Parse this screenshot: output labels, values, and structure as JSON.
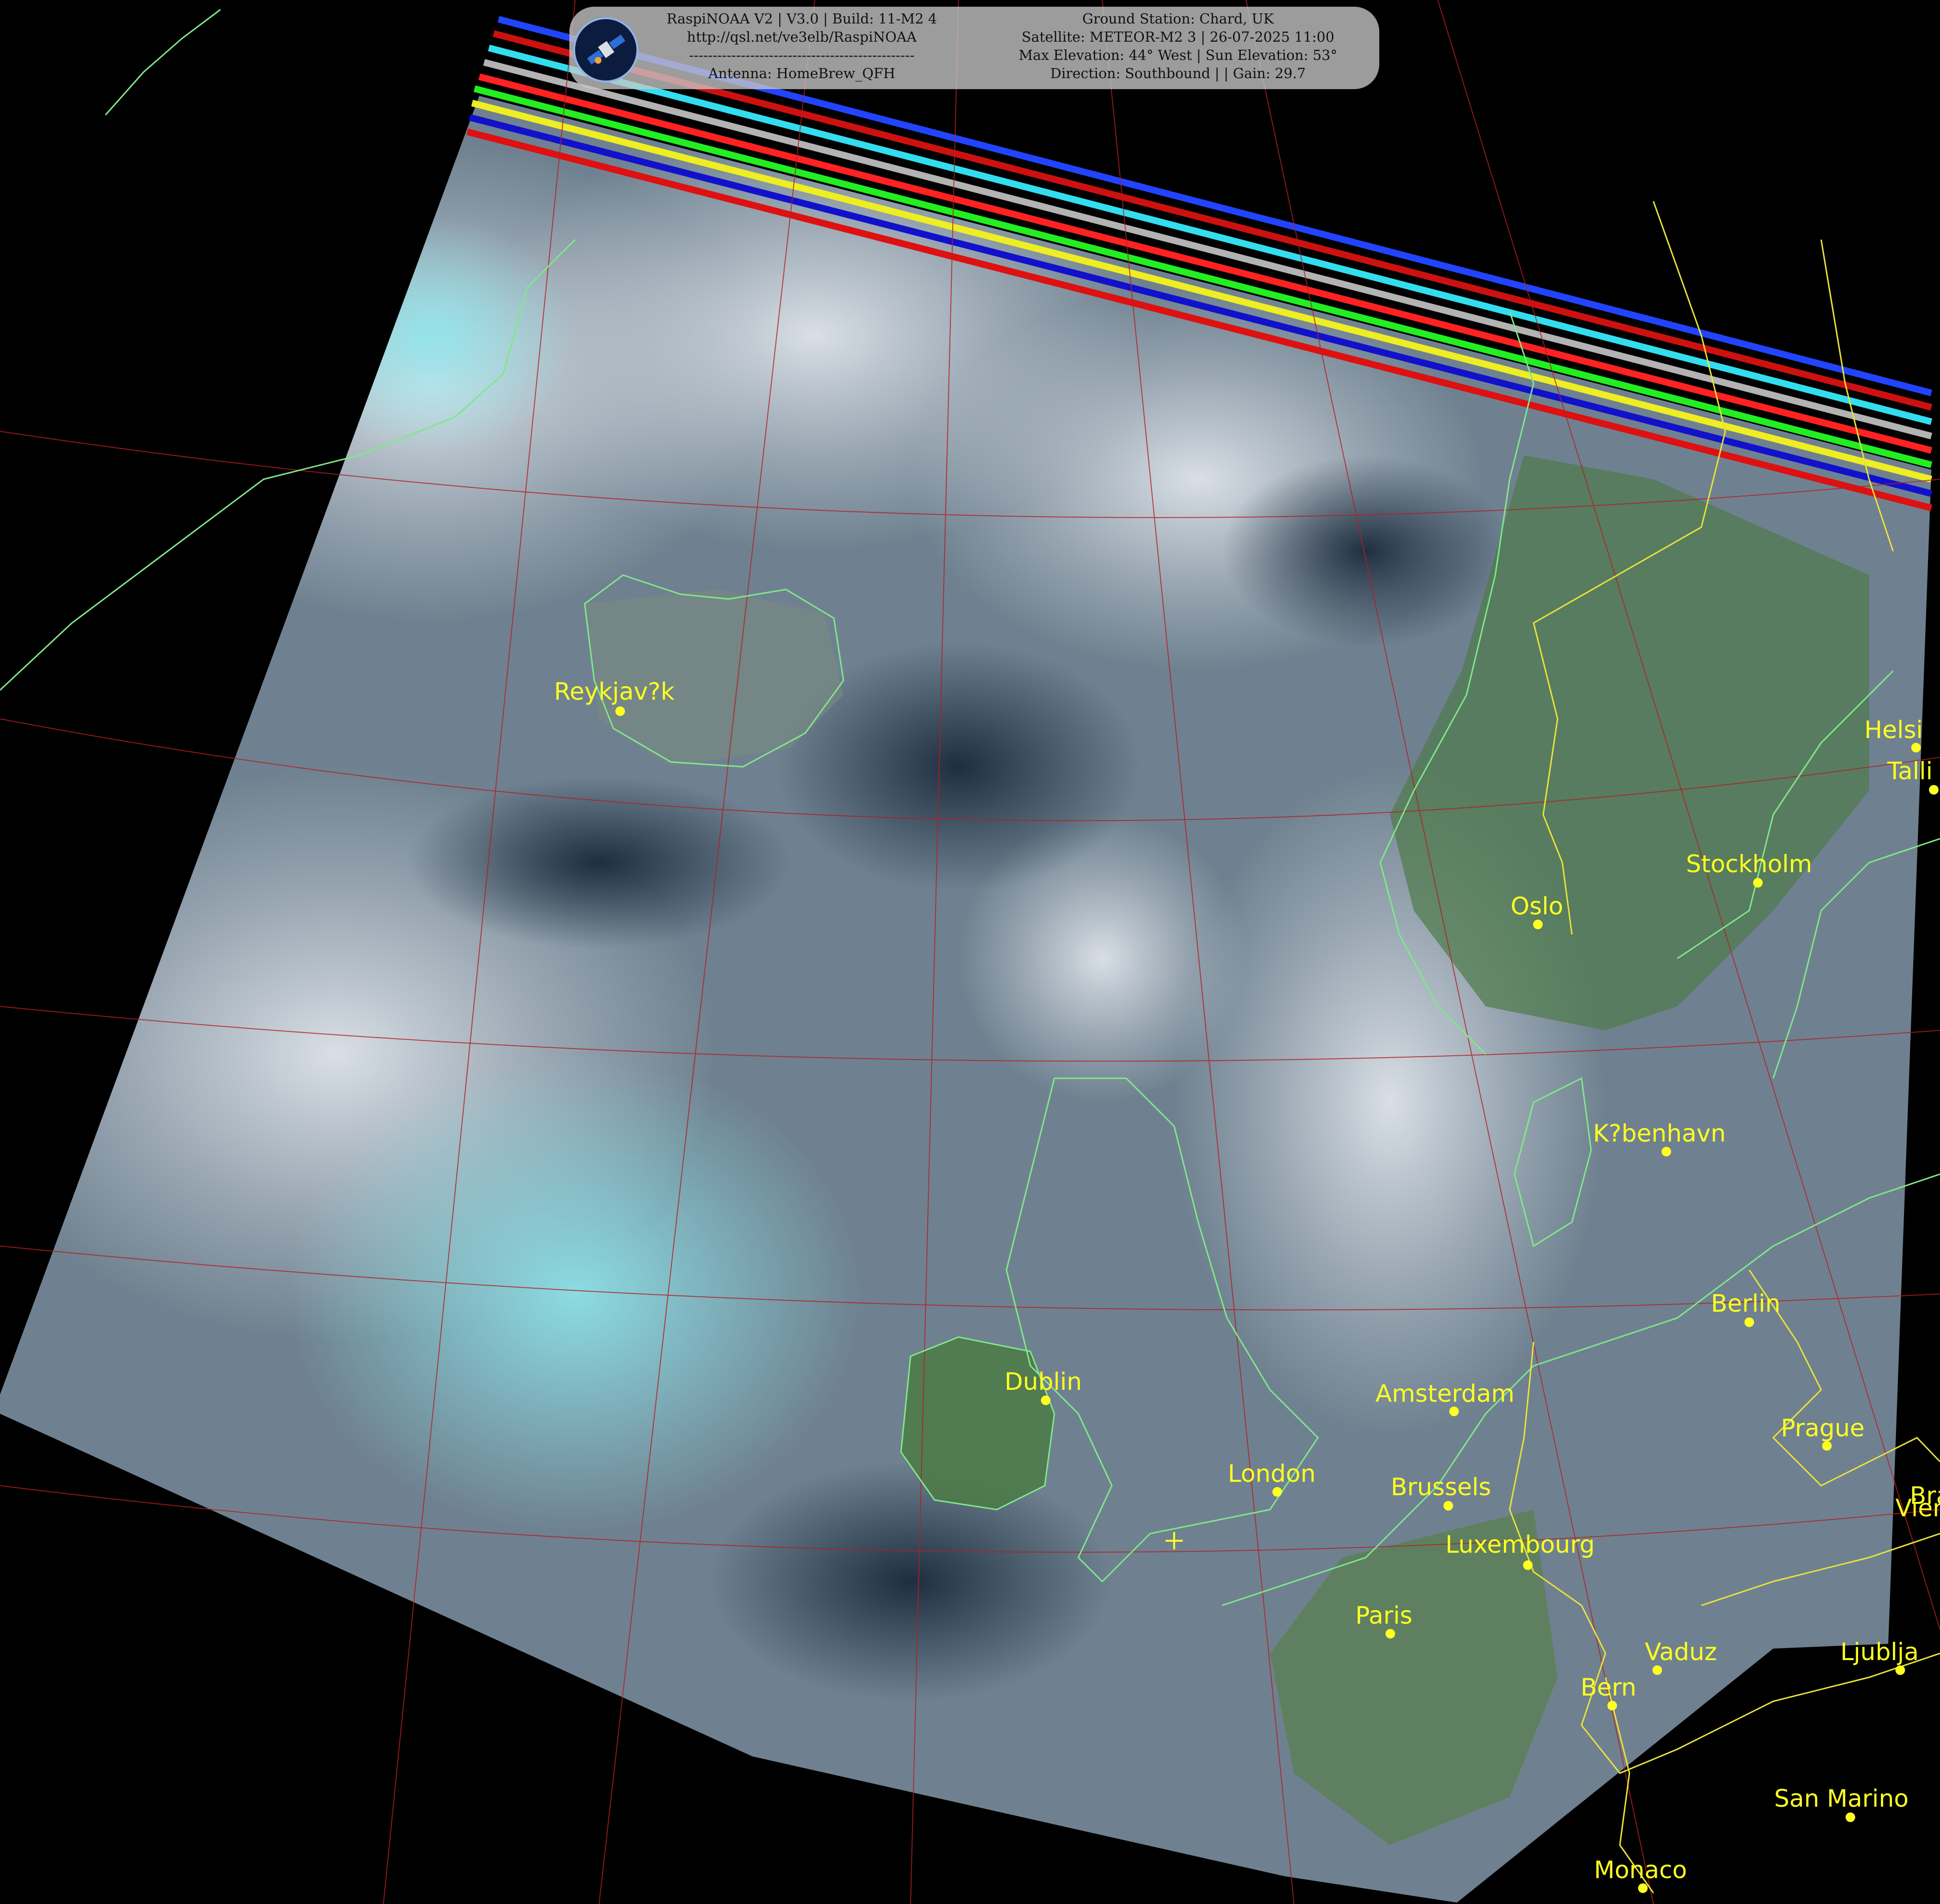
{
  "header": {
    "left_lines": [
      "RaspiNOAA V2 | V3.0 | Build: 11-M2 4",
      "http://qsl.net/ve3elb/RaspiNOAA",
      "------------------------------------------------",
      "Antenna: HomeBrew_QFH"
    ],
    "right_lines": [
      "Ground Station: Chard, UK",
      "Satellite: METEOR-M2 3 | 26-07-2025 11:00",
      "Max Elevation: 44° West | Sun Elevation: 53°",
      "Direction: Southbound | | Gain: 29.7"
    ]
  },
  "cities": [
    {
      "name": "Reykjav?k"
    },
    {
      "name": "Helsi"
    },
    {
      "name": "Talli"
    },
    {
      "name": "Stockholm"
    },
    {
      "name": "Oslo"
    },
    {
      "name": "K?benhavn"
    },
    {
      "name": "Berlin"
    },
    {
      "name": "Amsterdam"
    },
    {
      "name": "Dublin"
    },
    {
      "name": "Prague"
    },
    {
      "name": "London"
    },
    {
      "name": "Brussels"
    },
    {
      "name": "Vien"
    },
    {
      "name": "Bra"
    },
    {
      "name": "Luxembourg"
    },
    {
      "name": "Paris"
    },
    {
      "name": "Vaduz"
    },
    {
      "name": "Ljublja"
    },
    {
      "name": "Bern"
    },
    {
      "name": "San Marino"
    },
    {
      "name": "Monaco"
    }
  ],
  "colors": {
    "coastline": "#7fe88a",
    "border": "#e8e23a",
    "graticule": "#b02020",
    "label": "#ffff22"
  }
}
